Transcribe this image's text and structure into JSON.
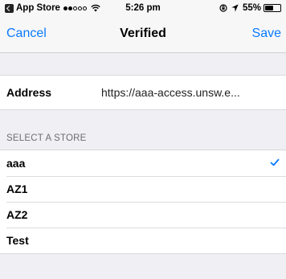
{
  "status_bar": {
    "carrier": "App Store",
    "signal_bars_filled": 2,
    "signal_bars_total": 5,
    "time": "5:26 pm",
    "battery_percent": "55%",
    "battery_level": 0.55,
    "icons": [
      "back-app-icon",
      "signal-dots",
      "wifi-icon",
      "orientation-lock-icon",
      "location-icon",
      "battery-icon"
    ]
  },
  "nav": {
    "cancel_label": "Cancel",
    "title": "Verified",
    "save_label": "Save",
    "accent_color": "#0a7aff"
  },
  "address": {
    "label": "Address",
    "value": "https://aaa-access.unsw.e..."
  },
  "stores": {
    "section_header": "SELECT A STORE",
    "items": [
      {
        "label": "aaa",
        "selected": true
      },
      {
        "label": "AZ1",
        "selected": false
      },
      {
        "label": "AZ2",
        "selected": false
      },
      {
        "label": "Test",
        "selected": false
      }
    ]
  }
}
